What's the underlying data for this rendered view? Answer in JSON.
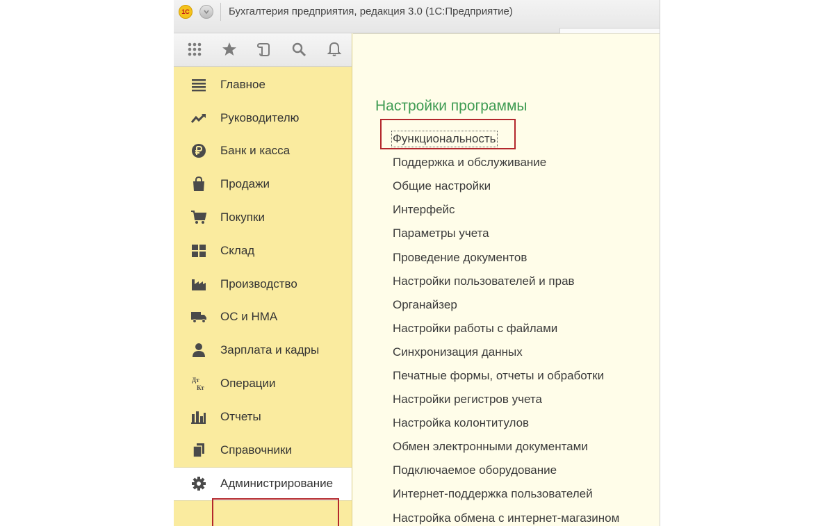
{
  "window": {
    "title": "Бухгалтерия предприятия, редакция 3.0  (1С:Предприятие)",
    "logo_text": "1С"
  },
  "toolbar": {
    "icons": [
      "apps-grid-icon",
      "favorites-star-icon",
      "history-icon",
      "search-icon",
      "notifications-bell-icon"
    ]
  },
  "sidebar": {
    "items": [
      {
        "label": "Главное",
        "icon": "menu-lines-icon"
      },
      {
        "label": "Руководителю",
        "icon": "trend-chart-icon"
      },
      {
        "label": "Банк и касса",
        "icon": "ruble-coin-icon"
      },
      {
        "label": "Продажи",
        "icon": "shopping-bag-icon"
      },
      {
        "label": "Покупки",
        "icon": "shopping-cart-icon"
      },
      {
        "label": "Склад",
        "icon": "warehouse-grid-icon"
      },
      {
        "label": "Производство",
        "icon": "factory-icon"
      },
      {
        "label": "ОС и НМА",
        "icon": "truck-icon"
      },
      {
        "label": "Зарплата и кадры",
        "icon": "person-icon"
      },
      {
        "label": "Операции",
        "icon": "debit-credit-icon"
      },
      {
        "label": "Отчеты",
        "icon": "bar-chart-icon"
      },
      {
        "label": "Справочники",
        "icon": "documents-stack-icon"
      },
      {
        "label": "Администрирование",
        "icon": "gear-icon"
      }
    ],
    "active_item": "Администрирование"
  },
  "main": {
    "section_title": "Настройки программы",
    "links": [
      "Функциональность",
      "Поддержка и обслуживание",
      "Общие настройки",
      "Интерфейс",
      "Параметры учета",
      "Проведение документов",
      "Настройки пользователей и прав",
      "Органайзер",
      "Настройки работы с файлами",
      "Синхронизация данных",
      "Печатные формы, отчеты и обработки",
      "Настройки регистров учета",
      "Настройка колонтитулов",
      "Обмен электронными документами",
      "Подключаемое оборудование",
      "Интернет-поддержка пользователей",
      "Настройка обмена с интернет-магазином"
    ],
    "focused_link": "Функциональность"
  },
  "colors": {
    "sidebar_bg": "#faeb9f",
    "content_bg": "#fffde9",
    "section_title": "#3e9b52",
    "highlight_border": "#b3272c"
  }
}
